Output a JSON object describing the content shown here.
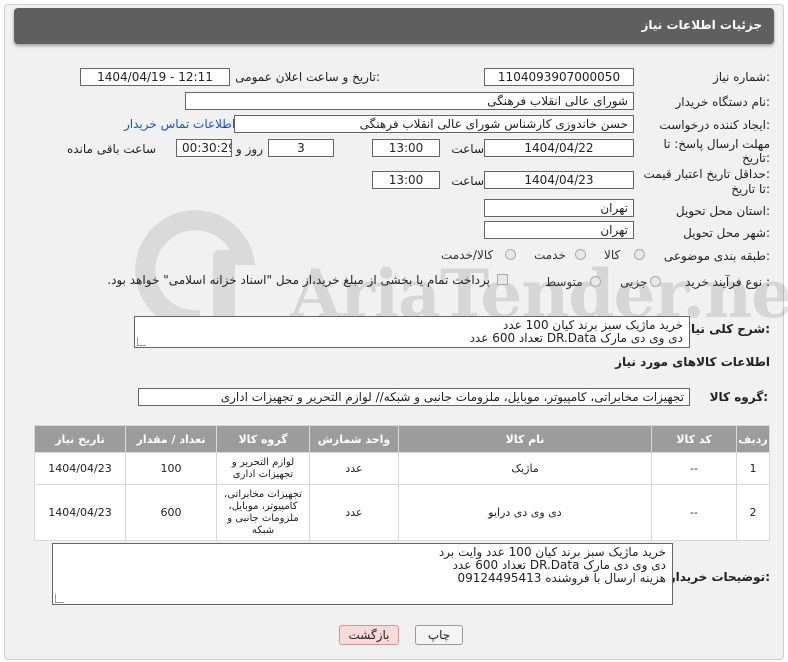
{
  "header": {
    "title": "جزئیات اطلاعات نیاز"
  },
  "form": {
    "need_number_label": "شماره نیاز:",
    "need_number": "1104093907000050",
    "announce_label": "تاریخ و ساعت اعلان عمومی:",
    "announce_value": "1404/04/19 - 12:11",
    "buyer_org_label": "نام دستگاه خریدار:",
    "buyer_org": "شورای عالی انقلاب فرهنگی",
    "creator_label": "ایجاد کننده درخواست:",
    "creator": "حسن خاندوزی کارشناس شورای عالی انقلاب فرهنگی",
    "buyer_contact_link": "اطلاعات تماس خریدار",
    "deadline_label_1": "مهلت ارسال پاسخ: تا",
    "deadline_label_2": "تاریخ:",
    "deadline_date": "1404/04/22",
    "time_label": "ساعت",
    "deadline_time": "13:00",
    "days_value": "3",
    "days_label": "روز و",
    "remaining_value": "00:30:29",
    "remaining_label": "ساعت باقی مانده",
    "validity_label_1": "حداقل تاریخ اعتبار قیمت:",
    "validity_label_2": "تا تاریخ:",
    "validity_date": "1404/04/23",
    "validity_time": "13:00",
    "province_label": "استان محل تحویل:",
    "province": "تهران",
    "city_label": "شهر محل تحویل:",
    "city": "تهران",
    "category_label": "طبقه بندی موضوعی:",
    "category_options": [
      "کالا",
      "خدمت",
      "کالا/خدمت"
    ],
    "process_label": "نوع فرآیند خرید :",
    "process_options": [
      "جزیی",
      "متوسط"
    ],
    "payment_note": "پرداخت تمام یا بخشی از مبلغ خرید،از محل \"اسناد خزانه اسلامی\" خواهد بود.",
    "summary_label": "شرح کلی نیاز:",
    "summary_lines": [
      "خرید ماژیک سبز برند کیان 100 عدد",
      "دی وی دی مارک DR.Data تعداد 600 عدد"
    ],
    "goods_info_title": "اطلاعات کالاهای مورد نیاز",
    "goods_group_label": "گروه کالا:",
    "goods_group": "تجهیزات مخابراتی، کامپیوتر، موبایل، ملزومات جانبی و شبکه// لوازم التحریر و تجهیزات اداری"
  },
  "table": {
    "headers": [
      "ردیف",
      "کد کالا",
      "نام کالا",
      "واحد شمارش",
      "گروه کالا",
      "تعداد / مقدار",
      "تاریخ نیاز"
    ],
    "rows": [
      {
        "row": "1",
        "code": "--",
        "name": "ماژیک",
        "unit": "عدد",
        "group": "لوازم التحریر و تجهیزات اداری",
        "qty": "100",
        "date": "1404/04/23"
      },
      {
        "row": "2",
        "code": "--",
        "name": "دی وی دی درایو",
        "unit": "عدد",
        "group": "تجهیزات مخابراتی، کامپیوتر، موبایل، ملزومات جانبی و شبکه",
        "qty": "600",
        "date": "1404/04/23"
      }
    ]
  },
  "buyer_notes": {
    "label": "توضیحات خریدار:",
    "lines": [
      "خرید ماژیک سبز برند کیان 100 عدد وایت برد",
      "دی وی دی مارک DR.Data تعداد 600 عدد",
      "هزینه ارسال با فروشنده 09124495413"
    ]
  },
  "buttons": {
    "print": "چاپ",
    "back": "بازگشت"
  },
  "watermark": {
    "text": "AriaTender.neT"
  },
  "icons": {
    "radio": "radio-circle",
    "checkbox": "checkbox-square",
    "watermark_logo": "watermark-logo-icon"
  }
}
